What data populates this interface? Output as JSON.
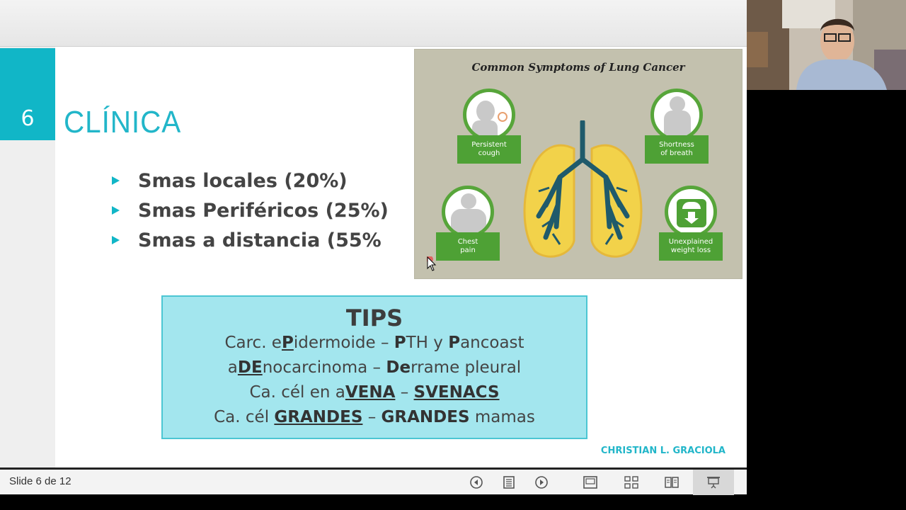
{
  "slide": {
    "number": "6",
    "title": "CLÍNICA",
    "bullets": [
      "Smas locales (20%)",
      "Smas Periféricos (25%)",
      "Smas a distancia (55%"
    ],
    "infographic": {
      "title": "Common Symptoms of Lung Cancer",
      "symptoms": [
        {
          "line1": "Persistent",
          "line2": "cough"
        },
        {
          "line1": "Shortness",
          "line2": "of breath"
        },
        {
          "line1": "Chest",
          "line2": "pain"
        },
        {
          "line1": "Unexplained",
          "line2": "weight loss"
        }
      ]
    },
    "tips": {
      "heading": "TIPS",
      "line1": {
        "a": "Carc. e",
        "b": "P",
        "c": "idermoide – ",
        "d": "P",
        "e": "TH y ",
        "f": "P",
        "g": "ancoast"
      },
      "line2": {
        "a": "a",
        "b": "DE",
        "c": "nocarcinoma – ",
        "d": "De",
        "e": "rrame pleural"
      },
      "line3": {
        "a": "Ca. cél en a",
        "b": "VENA",
        "c": " – ",
        "d": "SVENACS"
      },
      "line4": {
        "a": "Ca. cél ",
        "b": "GRANDES",
        "c": " – ",
        "d": "GRANDES",
        "e": " mamas"
      }
    },
    "author": "CHRISTIAN L. GRACIOLA"
  },
  "statusbar": {
    "slide_count": "Slide 6 de 12"
  },
  "colors": {
    "accent": "#11b6c7",
    "tips_bg": "#a3e6ee",
    "green": "#4ea135"
  },
  "icons": [
    "previous-icon",
    "notes-icon",
    "next-icon",
    "normal-view-icon",
    "slide-sorter-icon",
    "reading-view-icon",
    "slideshow-icon"
  ]
}
